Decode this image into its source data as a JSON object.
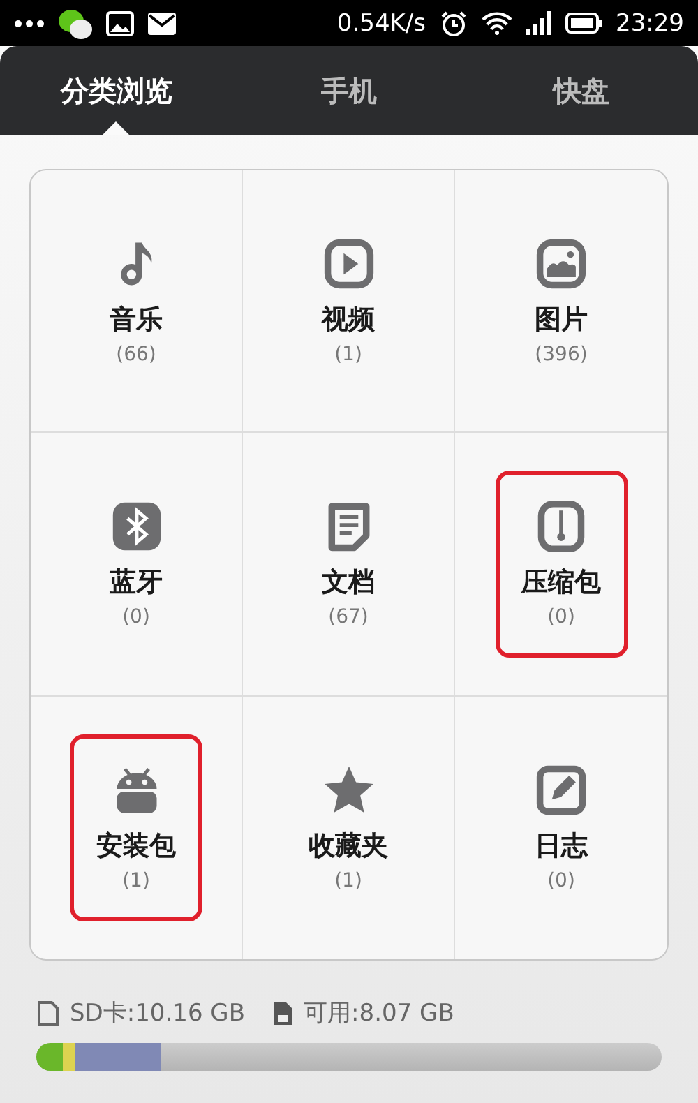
{
  "status_bar": {
    "speed": "0.54K/s",
    "time": "23:29"
  },
  "tabs": [
    {
      "label": "分类浏览",
      "selected": true
    },
    {
      "label": "手机",
      "selected": false
    },
    {
      "label": "快盘",
      "selected": false
    }
  ],
  "categories": [
    {
      "kind": "music",
      "name": "音乐",
      "count": "(66)",
      "highlighted": false
    },
    {
      "kind": "video",
      "name": "视频",
      "count": "(1)",
      "highlighted": false
    },
    {
      "kind": "image",
      "name": "图片",
      "count": "(396)",
      "highlighted": false
    },
    {
      "kind": "bluetooth",
      "name": "蓝牙",
      "count": "(0)",
      "highlighted": false
    },
    {
      "kind": "document",
      "name": "文档",
      "count": "(67)",
      "highlighted": false
    },
    {
      "kind": "archive",
      "name": "压缩包",
      "count": "(0)",
      "highlighted": true
    },
    {
      "kind": "apk",
      "name": "安装包",
      "count": "(1)",
      "highlighted": true
    },
    {
      "kind": "favorite",
      "name": "收藏夹",
      "count": "(1)",
      "highlighted": false
    },
    {
      "kind": "log",
      "name": "日志",
      "count": "(0)",
      "highlighted": false
    }
  ],
  "storage": {
    "total": "SD卡:10.16 GB",
    "available": "可用:8.07 GB",
    "segments": [
      {
        "color": "#6ab72a",
        "level": 0.043
      },
      {
        "color": "#ddd350",
        "level": 0.02
      },
      {
        "color": "#8089b5",
        "level": 0.136
      }
    ]
  }
}
